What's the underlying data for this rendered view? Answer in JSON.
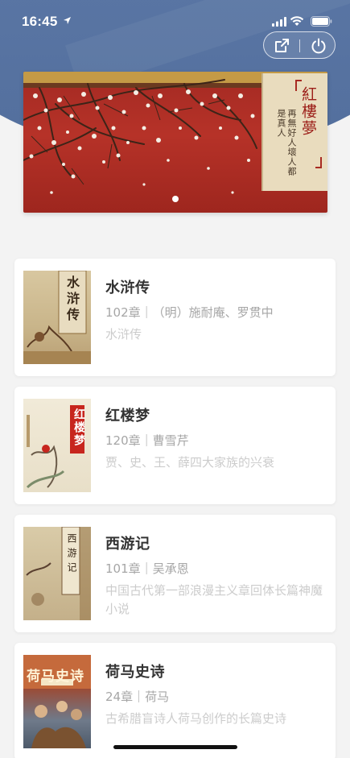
{
  "status_bar": {
    "time": "16:45"
  },
  "capsule": {
    "share_icon": "share-icon",
    "power_icon": "power-icon"
  },
  "banner": {
    "title": "紅樓夢",
    "subtitle": "再無好人壞人都是真人",
    "dots": 1,
    "colors": {
      "background": "#a42a23",
      "panel": "#e9dcbe"
    }
  },
  "books": [
    {
      "title": "水浒传",
      "meta": "102章｜（明）施耐庵、罗贯中",
      "desc": "水浒传",
      "cover_text": "水浒传"
    },
    {
      "title": "红楼梦",
      "meta": "120章｜曹雪芹",
      "desc": "贾、史、王、薛四大家族的兴衰",
      "cover_text": "红楼梦"
    },
    {
      "title": "西游记",
      "meta": "101章｜吴承恩",
      "desc": "中国古代第一部浪漫主义章回体长篇神魔小说",
      "cover_text": "西游记"
    },
    {
      "title": "荷马史诗",
      "meta": "24章｜荷马",
      "desc": "古希腊盲诗人荷马创作的长篇史诗",
      "cover_text": "荷马史诗"
    }
  ],
  "colors": {
    "header": "#5d79a8",
    "title_text": "#333333",
    "meta_text": "#a6a6a6",
    "desc_text": "#cccccc"
  }
}
